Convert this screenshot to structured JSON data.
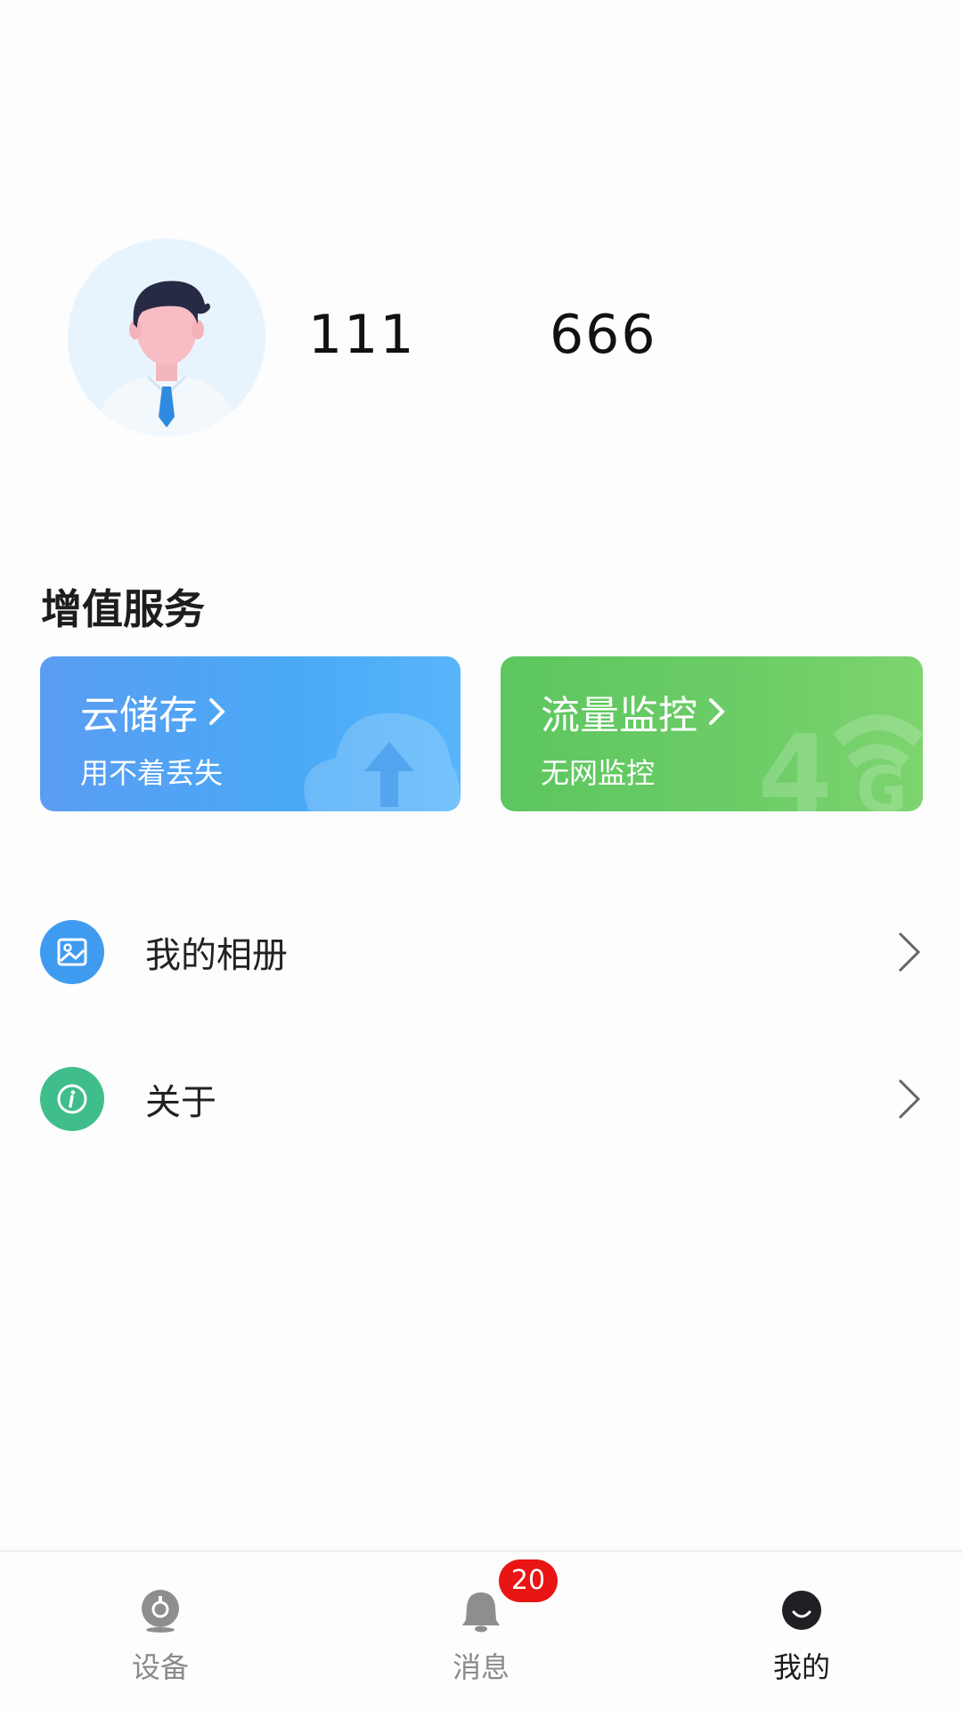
{
  "profile": {
    "stat_left": "111",
    "stat_right": "666"
  },
  "services": {
    "title": "增值服务",
    "cards": [
      {
        "title": "云储存",
        "subtitle": "用不着丢失",
        "color": "#4aa9f6",
        "icon": "cloud-upload-icon"
      },
      {
        "title": "流量监控",
        "subtitle": "无网监控",
        "color": "#6ccd67",
        "icon": "4g-signal-icon"
      }
    ]
  },
  "menu": [
    {
      "label": "我的相册",
      "icon": "photo-album-icon",
      "color": "#3f9bf0"
    },
    {
      "label": "关于",
      "icon": "info-icon",
      "color": "#3fbd8a"
    }
  ],
  "bottom_nav": {
    "items": [
      {
        "label": "设备",
        "icon": "camera-icon",
        "active": false
      },
      {
        "label": "消息",
        "icon": "bell-icon",
        "active": false,
        "badge": "20"
      },
      {
        "label": "我的",
        "icon": "user-face-icon",
        "active": true
      }
    ],
    "badge_color": "#e91414"
  }
}
